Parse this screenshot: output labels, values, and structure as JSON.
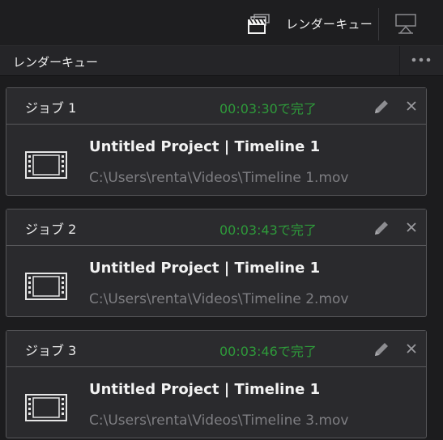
{
  "topbar": {
    "render_queue_label": "レンダーキュー",
    "clapper_icon": "render-queue-clapper-icon",
    "monitor_icon": "monitor-icon"
  },
  "panel": {
    "title": "レンダーキュー",
    "more_icon": "more-options-icon"
  },
  "jobs": [
    {
      "name": "ジョブ 1",
      "status": "00:03:30で完了",
      "title": "Untitled Project | Timeline 1",
      "path": "C:\\Users\\renta\\Videos\\Timeline 1.mov"
    },
    {
      "name": "ジョブ 2",
      "status": "00:03:43で完了",
      "title": "Untitled Project | Timeline 1",
      "path": "C:\\Users\\renta\\Videos\\Timeline 2.mov"
    },
    {
      "name": "ジョブ 3",
      "status": "00:03:46で完了",
      "title": "Untitled Project | Timeline 1",
      "path": "C:\\Users\\renta\\Videos\\Timeline 3.mov"
    }
  ],
  "colors": {
    "status_complete": "#2e9a3a",
    "background": "#1c1c1e",
    "card_background": "#2a2a2d"
  }
}
